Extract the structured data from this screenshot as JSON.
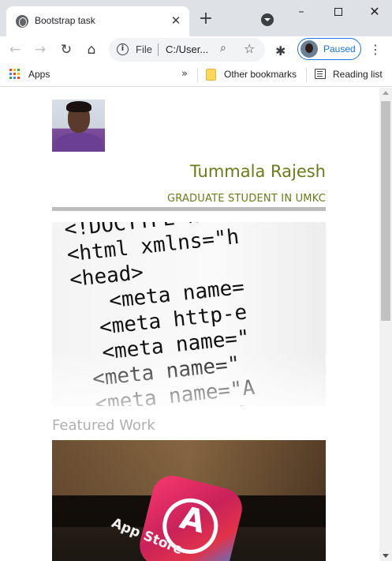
{
  "browser": {
    "tab": {
      "title": "Bootstrap task",
      "close_glyph": "✕"
    },
    "new_tab_glyph": "+",
    "window": {
      "minimize": "–",
      "close": "✕"
    },
    "nav": {
      "back": "←",
      "forward": "→",
      "reload": "↻",
      "home": "⌂"
    },
    "omnibox": {
      "info": "i",
      "scheme": "File",
      "url": "C:/User...",
      "zoom": "⌕",
      "star": "☆"
    },
    "extensions_glyph": "✱",
    "profile": {
      "label": "Paused"
    },
    "menu_glyph": "⋮",
    "bookmarks": {
      "apps": "Apps",
      "overflow": "»",
      "other": "Other bookmarks",
      "reading_list": "Reading list"
    }
  },
  "page": {
    "name": "Tummala Rajesh",
    "subtitle": "GRADUATE STUDENT IN UMKC",
    "hero_code": "<!DOCTYPE html PUBLIC\n<html xmlns=\"h\n<head>\n   <meta name=\n  <meta http-e\n  <meta name=\"\n <meta name=\"\n <meta name=\"A\n<meta name=\"d\n<meta name",
    "featured_heading": "Featured Work",
    "featured_image": {
      "label": "App Store"
    }
  },
  "colors": {
    "accent": "#6b7a1a",
    "muted_heading": "#b0b0b0",
    "rule": "#bdbdbd",
    "profile_button": "#1a73e8"
  },
  "icons": [
    "globe-icon",
    "close-icon",
    "plus-icon",
    "tab-search-icon",
    "minimize-icon",
    "maximize-icon",
    "back-icon",
    "forward-icon",
    "reload-icon",
    "home-icon",
    "info-icon",
    "zoom-icon",
    "star-icon",
    "extensions-icon",
    "avatar",
    "menu-icon",
    "apps-grid-icon",
    "folder-icon",
    "reading-list-icon"
  ]
}
